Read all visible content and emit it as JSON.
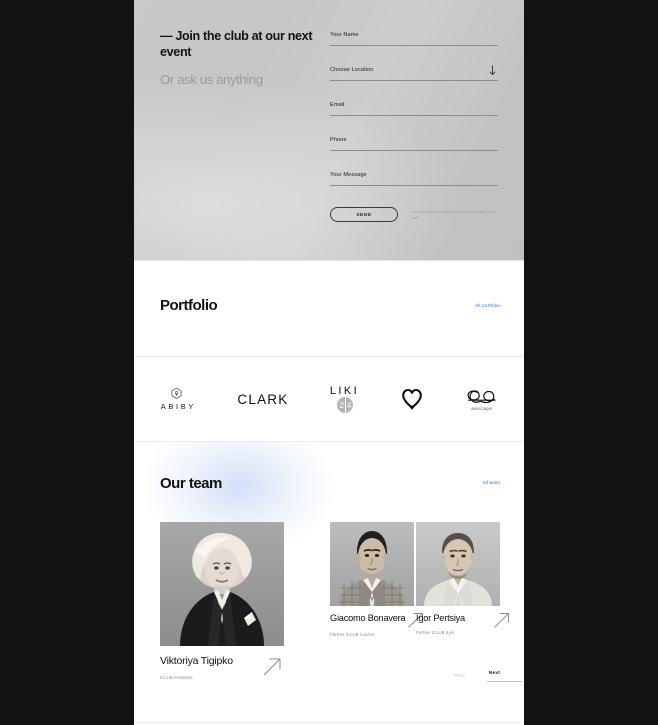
{
  "contact": {
    "heading": "— Join the club at our next event",
    "subheading": "Or ask us anything",
    "fields": [
      {
        "label": "Your Name",
        "value": "",
        "icon": ""
      },
      {
        "label": "Choose Location",
        "value": "",
        "icon": "arrow-down-icon"
      },
      {
        "label": "Email",
        "value": "",
        "icon": ""
      },
      {
        "label": "Phone",
        "value": "",
        "icon": ""
      },
      {
        "label": "Your Message",
        "value": "",
        "icon": ""
      }
    ],
    "submit_label": "SEND",
    "privacy_note": "We will keep your personal information private and safe."
  },
  "portfolio": {
    "title": "Portfolio",
    "link_label": "All portfolio",
    "logos": [
      {
        "name": "ABIBY",
        "mark": "abiby-flower-icon"
      },
      {
        "name": "CLARK",
        "mark": ""
      },
      {
        "name": "LIKI",
        "badge": "24",
        "mark": ""
      },
      {
        "name": "",
        "mark": "heart-icon"
      },
      {
        "name": "aescape",
        "mark": "ae-ligature-icon"
      }
    ]
  },
  "team": {
    "title": "Our team",
    "link_label": "All team",
    "members": [
      {
        "name": "Viktoriya Tigipko",
        "role": "ICLUB President",
        "arrow": "arrow-up-right-icon"
      },
      {
        "name": "Giacomo Bonavera",
        "role": "Partner ICLUB London",
        "arrow": "arrow-up-right-icon"
      },
      {
        "name": "Igor Pertsiya",
        "role": "Partner ICLUB Kyiv",
        "arrow": "arrow-up-right-icon"
      }
    ],
    "prev_label": "Prev",
    "next_label": "Next"
  },
  "colors": {
    "accent_link": "#2f6bff",
    "text_primary": "#121212",
    "text_muted": "#8c8c8c",
    "contact_bg": "#c8c8c8",
    "page_bg": "#ffffff",
    "viewport_bg": "#121212"
  }
}
